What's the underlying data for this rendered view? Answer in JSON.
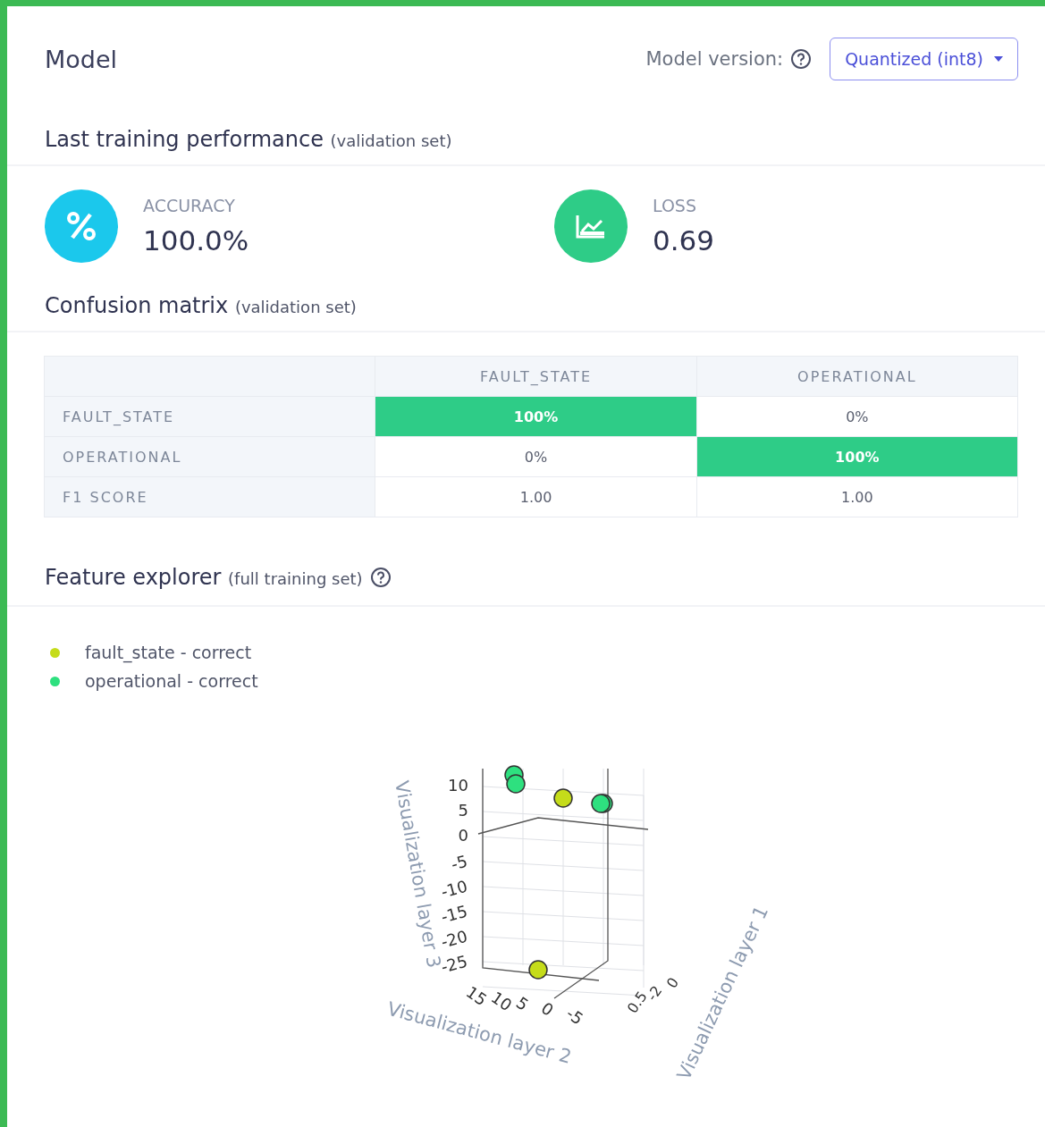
{
  "header": {
    "title": "Model",
    "version_label": "Model version:",
    "version_value": "Quantized (int8)"
  },
  "performance": {
    "title": "Last training performance",
    "subtitle": "(validation set)",
    "metrics": [
      {
        "kind": "accuracy",
        "label": "ACCURACY",
        "value": "100.0%",
        "color": "#1bc8ec"
      },
      {
        "kind": "loss",
        "label": "LOSS",
        "value": "0.69",
        "color": "#2ecc87"
      }
    ]
  },
  "confusion": {
    "title": "Confusion matrix",
    "subtitle": "(validation set)",
    "columns": [
      "FAULT_STATE",
      "OPERATIONAL"
    ],
    "rows": [
      {
        "label": "FAULT_STATE",
        "cells": [
          {
            "text": "100%",
            "highlight": true
          },
          {
            "text": "0%",
            "highlight": false
          }
        ]
      },
      {
        "label": "OPERATIONAL",
        "cells": [
          {
            "text": "0%",
            "highlight": false
          },
          {
            "text": "100%",
            "highlight": true
          }
        ]
      },
      {
        "label": "F1 SCORE",
        "cells": [
          {
            "text": "1.00",
            "highlight": false
          },
          {
            "text": "1.00",
            "highlight": false
          }
        ]
      }
    ]
  },
  "explorer": {
    "title": "Feature explorer",
    "subtitle": "(full training set)",
    "legend": [
      {
        "label": "fault_state - correct",
        "color": "#c5dc1a"
      },
      {
        "label": "operational - correct",
        "color": "#2ee07f"
      }
    ],
    "plot": {
      "z_title": "Visualization layer 3",
      "y_title": "Visualization layer 2",
      "x_title": "Visualization layer 1",
      "z_ticks": [
        "10",
        "5",
        "0",
        "-5",
        "-10",
        "-15",
        "-20",
        "-25"
      ],
      "y_ticks": [
        "15",
        "10",
        "5",
        "0",
        "-5"
      ],
      "x_ticks": [
        "0.5",
        "-2",
        "0"
      ]
    }
  }
}
